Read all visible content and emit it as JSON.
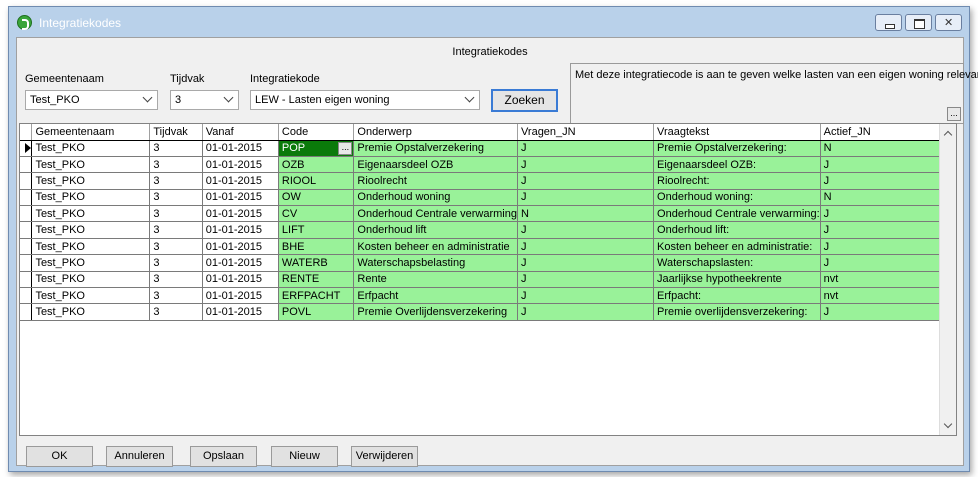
{
  "window": {
    "title": "Integratiekodes"
  },
  "form": {
    "title": "Integratiekodes"
  },
  "filters": {
    "gemeente_label": "Gemeentenaam",
    "gemeente_value": "Test_PKO",
    "tijdvak_label": "Tijdvak",
    "tijdvak_value": "3",
    "code_label": "Integratiekode",
    "code_value": "LEW - Lasten eigen woning",
    "search_label": "Zoeken"
  },
  "info": {
    "text": "Met deze integratiecode is aan te geven welke lasten van een eigen woning relevant zijn.",
    "button": "..."
  },
  "grid": {
    "columns": [
      "Gemeentenaam",
      "Tijdvak",
      "Vanaf",
      "Code",
      "Onderwerp",
      "Vragen_JN",
      "Vraagtekst",
      "Actief_JN"
    ],
    "cell_button": "...",
    "rows": [
      [
        "Test_PKO",
        "3",
        "01-01-2015",
        "POP",
        "Premie Opstalverzekering",
        "J",
        "Premie Opstalverzekering:",
        "N"
      ],
      [
        "Test_PKO",
        "3",
        "01-01-2015",
        "OZB",
        "Eigenaarsdeel OZB",
        "J",
        "Eigenaarsdeel OZB:",
        "J"
      ],
      [
        "Test_PKO",
        "3",
        "01-01-2015",
        "RIOOL",
        "Rioolrecht",
        "J",
        "Rioolrecht:",
        "J"
      ],
      [
        "Test_PKO",
        "3",
        "01-01-2015",
        "OW",
        "Onderhoud woning",
        "J",
        "Onderhoud woning:",
        "N"
      ],
      [
        "Test_PKO",
        "3",
        "01-01-2015",
        "CV",
        "Onderhoud Centrale verwarming",
        "N",
        "Onderhoud Centrale verwarming:",
        "J"
      ],
      [
        "Test_PKO",
        "3",
        "01-01-2015",
        "LIFT",
        "Onderhoud lift",
        "J",
        "Onderhoud lift:",
        "J"
      ],
      [
        "Test_PKO",
        "3",
        "01-01-2015",
        "BHE",
        "Kosten beheer en administratie",
        "J",
        "Kosten beheer en administratie:",
        "J"
      ],
      [
        "Test_PKO",
        "3",
        "01-01-2015",
        "WATERB",
        "Waterschapsbelasting",
        "J",
        "Waterschapslasten:",
        "J"
      ],
      [
        "Test_PKO",
        "3",
        "01-01-2015",
        "RENTE",
        "Rente",
        "J",
        "Jaarlijkse hypotheekrente",
        "nvt"
      ],
      [
        "Test_PKO",
        "3",
        "01-01-2015",
        "ERFPACHT",
        "Erfpacht",
        "J",
        "Erfpacht:",
        "nvt"
      ],
      [
        "Test_PKO",
        "3",
        "01-01-2015",
        "POVL",
        "Premie Overlijdensverzekering",
        "J",
        "Premie overlijdensverzekering:",
        "J"
      ]
    ]
  },
  "buttons": {
    "ok": "OK",
    "cancel": "Annuleren",
    "save": "Opslaan",
    "new": "Nieuw",
    "delete": "Verwijderen"
  },
  "colors": {
    "editable_cell": "#99f299",
    "current_cell": "#0a7a0a",
    "title_bar": "#b9d1ea"
  }
}
